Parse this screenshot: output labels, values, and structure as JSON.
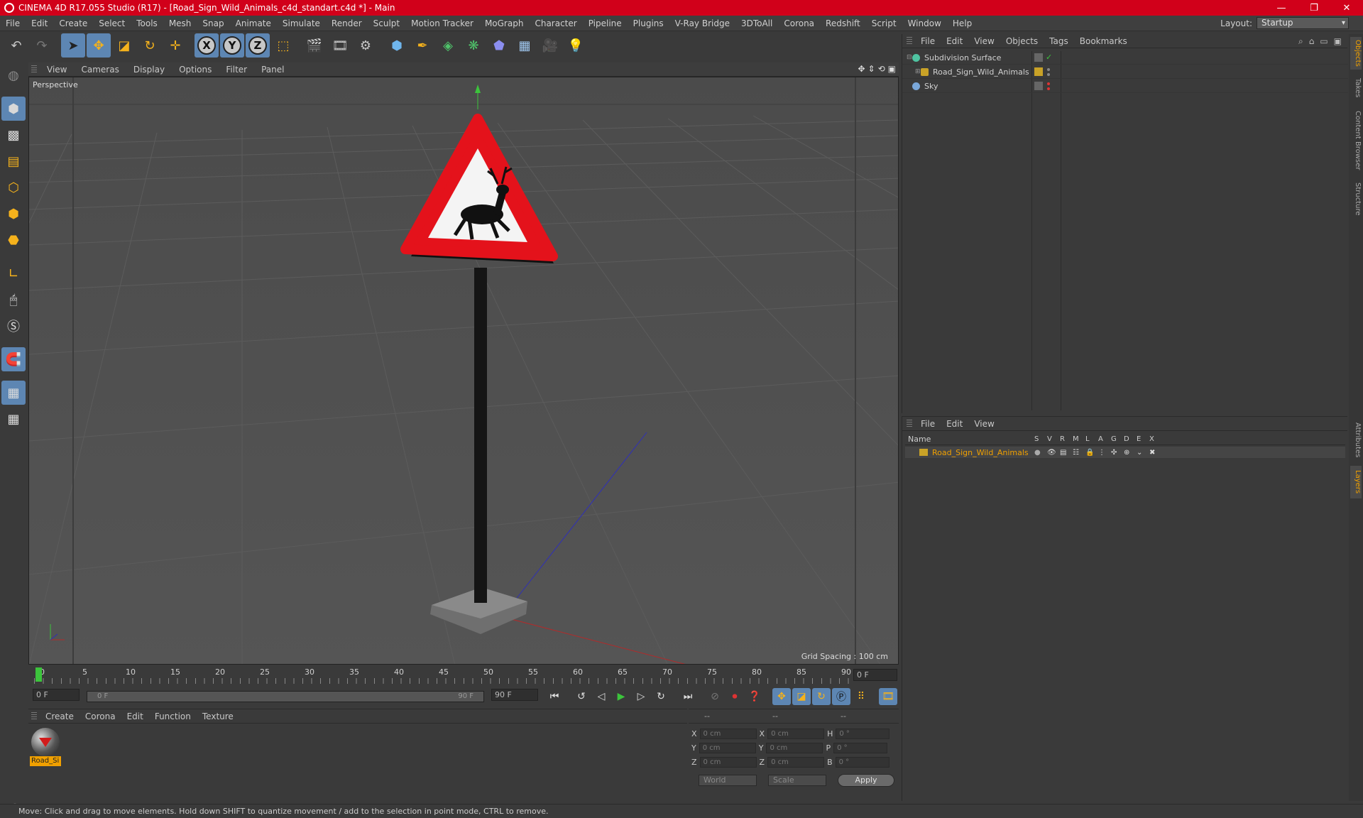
{
  "window": {
    "title": "CINEMA 4D R17.055 Studio (R17) - [Road_Sign_Wild_Animals_c4d_standart.c4d *] - Main",
    "controls": [
      "—",
      "❐",
      "✕"
    ]
  },
  "menubar": {
    "items": [
      "File",
      "Edit",
      "Create",
      "Select",
      "Tools",
      "Mesh",
      "Snap",
      "Animate",
      "Simulate",
      "Render",
      "Sculpt",
      "Motion Tracker",
      "MoGraph",
      "Character",
      "Pipeline",
      "Plugins",
      "V-Ray Bridge",
      "3DToAll",
      "Corona",
      "Redshift",
      "Script",
      "Window",
      "Help"
    ],
    "layout_label": "Layout:",
    "layout_value": "Startup"
  },
  "toolbar": {
    "axis_labels": [
      "X",
      "Y",
      "Z"
    ]
  },
  "viewport": {
    "menu": [
      "View",
      "Cameras",
      "Display",
      "Options",
      "Filter",
      "Panel"
    ],
    "label": "Perspective",
    "grid_spacing": "Grid Spacing : 100 cm"
  },
  "timeline": {
    "ticks": [
      "0",
      "5",
      "10",
      "15",
      "20",
      "25",
      "30",
      "35",
      "40",
      "45",
      "50",
      "55",
      "60",
      "65",
      "70",
      "75",
      "80",
      "85",
      "90"
    ],
    "current_frame": "0 F",
    "start_field": "0 F",
    "range_start": "0 F",
    "range_end": "90 F",
    "end_field": "90 F"
  },
  "material_manager": {
    "menu": [
      "Create",
      "Corona",
      "Edit",
      "Function",
      "Texture"
    ],
    "material_name": "Road_Si"
  },
  "coordinates": {
    "headers": [
      "--",
      "--",
      "--"
    ],
    "rows": [
      {
        "a": "X",
        "v1": "0 cm",
        "b": "X",
        "v2": "0 cm",
        "c": "H",
        "v3": "0 °"
      },
      {
        "a": "Y",
        "v1": "0 cm",
        "b": "Y",
        "v2": "0 cm",
        "c": "P",
        "v3": "0 °"
      },
      {
        "a": "Z",
        "v1": "0 cm",
        "b": "Z",
        "v2": "0 cm",
        "c": "B",
        "v3": "0 °"
      }
    ],
    "space_dropdown": "World",
    "mode_dropdown": "Scale",
    "apply_label": "Apply"
  },
  "object_manager": {
    "menu": [
      "File",
      "Edit",
      "View",
      "Objects",
      "Tags",
      "Bookmarks"
    ],
    "objects": [
      {
        "name": "Subdivision Surface",
        "icon_color": "#4fc3a1"
      },
      {
        "name": "Road_Sign_Wild_Animals",
        "icon_color": "#c9a227"
      },
      {
        "name": "Sky",
        "icon_color": "#7aa7d9"
      }
    ]
  },
  "layer_manager": {
    "menu": [
      "File",
      "Edit",
      "View"
    ],
    "name_header": "Name",
    "columns": [
      "S",
      "V",
      "R",
      "M",
      "L",
      "A",
      "G",
      "D",
      "E",
      "X"
    ],
    "layer_name": "Road_Sign_Wild_Animals",
    "layer_color": "#c9a227"
  },
  "side_tabs": [
    "Objects",
    "Takes",
    "Content Browser",
    "Structure",
    "Attributes",
    "Layers"
  ],
  "status": "Move: Click and drag to move elements. Hold down SHIFT to quantize movement / add to the selection in point mode, CTRL to remove.",
  "colors": {
    "accent": "#5d86b3",
    "title_bar": "#d1001a",
    "highlight": "#f0a000"
  }
}
